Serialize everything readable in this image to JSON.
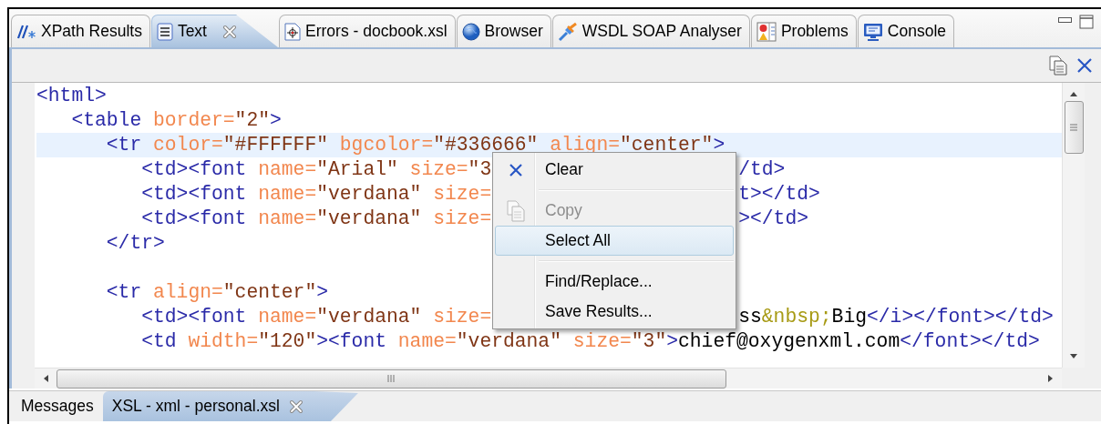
{
  "top_tabs": [
    {
      "label": "XPath Results",
      "selected": false,
      "closable": false
    },
    {
      "label": "Text",
      "selected": true,
      "closable": true
    },
    {
      "label": "Errors - docbook.xsl",
      "selected": false,
      "closable": false
    },
    {
      "label": "Browser",
      "selected": false,
      "closable": false
    },
    {
      "label": "WSDL SOAP Analyser",
      "selected": false,
      "closable": false
    },
    {
      "label": "Problems",
      "selected": false,
      "closable": false
    },
    {
      "label": "Console",
      "selected": false,
      "closable": false
    }
  ],
  "editor": {
    "lines": [
      {
        "kind": "code",
        "current": false,
        "tokens": [
          {
            "kind": "tag",
            "t": "<html>"
          }
        ],
        "children": [
          {
            "kind": "code",
            "current": false,
            "tokens": [
              {
                "kind": "tag",
                "t": "<table"
              },
              {
                "kind": "attr",
                "t": " border="
              },
              {
                "kind": "val",
                "t": "\"2\""
              },
              {
                "kind": "tag",
                "t": ">"
              }
            ],
            "children": [
              {
                "kind": "code",
                "current": true,
                "tokens": [
                  {
                    "kind": "tag",
                    "t": "<tr"
                  },
                  {
                    "kind": "attr",
                    "t": " color="
                  },
                  {
                    "kind": "val",
                    "t": "\"#FFFFFF\""
                  },
                  {
                    "kind": "attr",
                    "t": " bgcolor="
                  },
                  {
                    "kind": "val",
                    "t": "\"#336666\""
                  },
                  {
                    "kind": "attr",
                    "t": " align="
                  },
                  {
                    "kind": "val",
                    "t": "\"center\""
                  },
                  {
                    "kind": "tag",
                    "t": ">"
                  }
                ],
                "children": [
                  {
                    "kind": "code",
                    "current": false,
                    "tokens": [
                      {
                        "kind": "tag",
                        "t": "<td><font"
                      },
                      {
                        "kind": "attr",
                        "t": " name="
                      },
                      {
                        "kind": "val",
                        "t": "\"Arial\""
                      },
                      {
                        "kind": "attr",
                        "t": " size="
                      },
                      {
                        "kind": "val",
                        "t": "\"3"
                      }
                    ],
                    "tail": [
                      {
                        "kind": "tag",
                        "t": "/td>"
                      }
                    ]
                  },
                  {
                    "kind": "code",
                    "current": false,
                    "tokens": [
                      {
                        "kind": "tag",
                        "t": "<td><font"
                      },
                      {
                        "kind": "attr",
                        "t": " name="
                      },
                      {
                        "kind": "val",
                        "t": "\"verdana\""
                      },
                      {
                        "kind": "attr",
                        "t": " size="
                      }
                    ],
                    "tail": [
                      {
                        "kind": "tag",
                        "t": "t></td>"
                      }
                    ]
                  },
                  {
                    "kind": "code",
                    "current": false,
                    "tokens": [
                      {
                        "kind": "tag",
                        "t": "<td><font"
                      },
                      {
                        "kind": "attr",
                        "t": " name="
                      },
                      {
                        "kind": "val",
                        "t": "\"verdana\""
                      },
                      {
                        "kind": "attr",
                        "t": " size="
                      }
                    ],
                    "tail": [
                      {
                        "kind": "tag",
                        "t": "></td>"
                      }
                    ]
                  }
                ]
              },
              {
                "kind": "code",
                "current": false,
                "tokens": [
                  {
                    "kind": "tag",
                    "t": "</tr>"
                  }
                ]
              },
              {
                "kind": "blank",
                "current": false
              },
              {
                "kind": "code",
                "current": false,
                "tokens": [
                  {
                    "kind": "tag",
                    "t": "<tr"
                  },
                  {
                    "kind": "attr",
                    "t": " align="
                  },
                  {
                    "kind": "val",
                    "t": "\"center\""
                  },
                  {
                    "kind": "tag",
                    "t": ">"
                  }
                ],
                "children": [
                  {
                    "kind": "code",
                    "current": false,
                    "tokens": [
                      {
                        "kind": "tag",
                        "t": "<td><font"
                      },
                      {
                        "kind": "attr",
                        "t": " name="
                      },
                      {
                        "kind": "val",
                        "t": "\"verdana\""
                      },
                      {
                        "kind": "attr",
                        "t": " size="
                      }
                    ],
                    "tail": [
                      {
                        "kind": "text",
                        "t": "ss"
                      },
                      {
                        "kind": "entity",
                        "t": "&nbsp;"
                      },
                      {
                        "kind": "text",
                        "t": "Big"
                      },
                      {
                        "kind": "tag",
                        "t": "</i></font></td>"
                      }
                    ]
                  },
                  {
                    "kind": "code",
                    "current": false,
                    "tokens": [
                      {
                        "kind": "tag",
                        "t": "<td"
                      },
                      {
                        "kind": "attr",
                        "t": " width="
                      },
                      {
                        "kind": "val",
                        "t": "\"120\""
                      },
                      {
                        "kind": "tag",
                        "t": "><font"
                      },
                      {
                        "kind": "attr",
                        "t": " name="
                      },
                      {
                        "kind": "val",
                        "t": "\"verdana\""
                      },
                      {
                        "kind": "attr",
                        "t": " size="
                      },
                      {
                        "kind": "val",
                        "t": "\"3\""
                      },
                      {
                        "kind": "tag",
                        "t": ">"
                      },
                      {
                        "kind": "text",
                        "t": "chief@oxygenxml.com"
                      },
                      {
                        "kind": "tag",
                        "t": "</font></td>"
                      }
                    ]
                  }
                ]
              }
            ]
          }
        ]
      }
    ]
  },
  "context_menu": [
    {
      "kind": "item",
      "label": "Clear",
      "disabled": false,
      "selected": false
    },
    {
      "kind": "separator"
    },
    {
      "kind": "item",
      "label": "Copy",
      "disabled": true,
      "selected": false
    },
    {
      "kind": "item",
      "label": "Select All",
      "disabled": false,
      "selected": true
    },
    {
      "kind": "separator"
    },
    {
      "kind": "item",
      "label": "Find/Replace...",
      "disabled": false,
      "selected": false
    },
    {
      "kind": "item",
      "label": "Save Results...",
      "disabled": false,
      "selected": false
    }
  ],
  "bottom_tabs": [
    {
      "label": "Messages",
      "selected": false,
      "closable": false
    },
    {
      "label": "XSL - xml - personal.xsl",
      "selected": true,
      "closable": true
    }
  ]
}
